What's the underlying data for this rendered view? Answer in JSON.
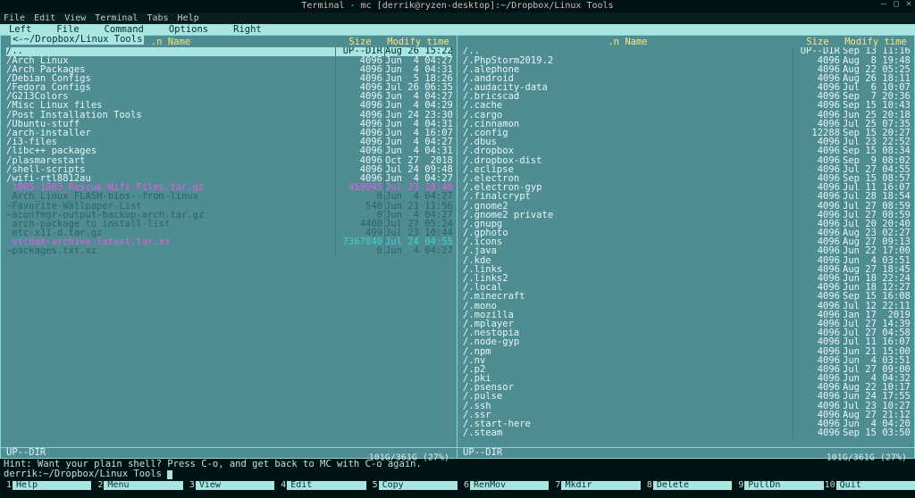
{
  "window": {
    "title": "Terminal - mc [derrik@ryzen-desktop]:~/Dropbox/Linux Tools"
  },
  "appmenu": [
    "File",
    "Edit",
    "View",
    "Terminal",
    "Tabs",
    "Help"
  ],
  "mcmenu": [
    "Left",
    "File",
    "Command",
    "Options",
    "Right"
  ],
  "left_path_caption": "<-~/Dropbox/Linux Tools",
  "headers": {
    "name": ".n          Name",
    "size": "Size",
    "mtime": "Modify time"
  },
  "left": {
    "status": "UP--DIR",
    "disk": "101G/361G (27%)",
    "items": [
      {
        "cls": "sel",
        "name": "/..",
        "size": "UP--DIR",
        "mtime": "Aug 26 15:22"
      },
      {
        "cls": "dir",
        "name": "/Arch Linux",
        "size": "4096",
        "mtime": "Jun  4 04:27"
      },
      {
        "cls": "dir",
        "name": "/Arch Packages",
        "size": "4096",
        "mtime": "Jun  4 04:31"
      },
      {
        "cls": "dir",
        "name": "/Debian Configs",
        "size": "4096",
        "mtime": "Jun  5 18:26"
      },
      {
        "cls": "dir",
        "name": "/Fedora Configs",
        "size": "4096",
        "mtime": "Jul 26 06:35"
      },
      {
        "cls": "dir",
        "name": "/G213Colors",
        "size": "4096",
        "mtime": "Jun  4 04:27"
      },
      {
        "cls": "dir",
        "name": "/Misc Linux files",
        "size": "4096",
        "mtime": "Jun  4 04:29"
      },
      {
        "cls": "dir",
        "name": "/Post Installation Tools",
        "size": "4096",
        "mtime": "Jun 24 23:30"
      },
      {
        "cls": "dir",
        "name": "/Ubuntu-stuff",
        "size": "4096",
        "mtime": "Jun  4 04:31"
      },
      {
        "cls": "dir",
        "name": "/arch-installer",
        "size": "4096",
        "mtime": "Jun  4 16:07"
      },
      {
        "cls": "dir",
        "name": "/i3-files",
        "size": "4096",
        "mtime": "Jun  4 04:27"
      },
      {
        "cls": "dir",
        "name": "/libc++ packages",
        "size": "4096",
        "mtime": "Jun  4 04:31"
      },
      {
        "cls": "dir",
        "name": "/plasmarestart",
        "size": "4096",
        "mtime": "Oct 27  2018"
      },
      {
        "cls": "dir",
        "name": "/shell-scripts",
        "size": "4096",
        "mtime": "Jul 24 09:48"
      },
      {
        "cls": "dir",
        "name": "/wifi-rtl8812au",
        "size": "4096",
        "mtime": "Jun  4 04:27"
      },
      {
        "cls": "mag",
        "name": " 1805-1803_Rescue-Wifi-Files.tar.gz",
        "size": "459945",
        "mtime": "Jul 23 18:40"
      },
      {
        "cls": "gray",
        "name": " Arch_Linux_FLASH-bios--from-linux",
        "size": "0",
        "mtime": "Jun  4 04:27"
      },
      {
        "cls": "gray",
        "name": "~Favorite-Wallpaper-List",
        "size": "540",
        "mtime": "Jun 21 11:56"
      },
      {
        "cls": "gray",
        "name": "~aconfmgr-output-backup-arch.tar.gz",
        "size": "0",
        "mtime": "Jun  4 04:27"
      },
      {
        "cls": "gray",
        "name": " arch-package_to_install-list",
        "size": "4400",
        "mtime": "Jul 27 05:24"
      },
      {
        "cls": "gray",
        "name": " etc-x11-d.tar.gz",
        "size": "499",
        "mtime": "Jul 23 10:44"
      },
      {
        "cls": "mag2",
        "name": " etcbak-archive-latest.tar.xz",
        "size": "7367840",
        "mtime": "Jul 24 04:55"
      },
      {
        "cls": "gray",
        "name": "~packages.txt.xz",
        "size": "0",
        "mtime": "Jun  4 04:27"
      }
    ]
  },
  "right": {
    "status": "UP--DIR",
    "disk": "101G/361G (27%)",
    "items": [
      {
        "cls": "dir",
        "name": "/..",
        "size": "UP--DIR",
        "mtime": "Sep 13 11:16"
      },
      {
        "cls": "dir",
        "name": "/.PhpStorm2019.2",
        "size": "4096",
        "mtime": "Aug  8 19:48"
      },
      {
        "cls": "dir",
        "name": "/.alephone",
        "size": "4096",
        "mtime": "Aug 22 05:25"
      },
      {
        "cls": "dir",
        "name": "/.android",
        "size": "4096",
        "mtime": "Aug 26 18:11"
      },
      {
        "cls": "dir",
        "name": "/.audacity-data",
        "size": "4096",
        "mtime": "Jul  6 10:07"
      },
      {
        "cls": "dir",
        "name": "/.bricscad",
        "size": "4096",
        "mtime": "Sep  7 20:36"
      },
      {
        "cls": "dir",
        "name": "/.cache",
        "size": "4096",
        "mtime": "Sep 15 10:43"
      },
      {
        "cls": "dir",
        "name": "/.cargo",
        "size": "4096",
        "mtime": "Jun 25 20:18"
      },
      {
        "cls": "dir",
        "name": "/.cinnamon",
        "size": "4096",
        "mtime": "Jul 25 07:35"
      },
      {
        "cls": "dir",
        "name": "/.config",
        "size": "12288",
        "mtime": "Sep 15 20:27"
      },
      {
        "cls": "dir",
        "name": "/.dbus",
        "size": "4096",
        "mtime": "Jul 23 22:52"
      },
      {
        "cls": "dir",
        "name": "/.dropbox",
        "size": "4096",
        "mtime": "Sep 15 08:34"
      },
      {
        "cls": "dir",
        "name": "/.dropbox-dist",
        "size": "4096",
        "mtime": "Sep  9 08:02"
      },
      {
        "cls": "dir",
        "name": "/.eclipse",
        "size": "4096",
        "mtime": "Jul 27 04:55"
      },
      {
        "cls": "dir",
        "name": "/.electron",
        "size": "4096",
        "mtime": "Sep 15 08:57"
      },
      {
        "cls": "dir",
        "name": "/.electron-gyp",
        "size": "4096",
        "mtime": "Jul 11 16:07"
      },
      {
        "cls": "dir",
        "name": "/.finalcrypt",
        "size": "4096",
        "mtime": "Jul 28 18:54"
      },
      {
        "cls": "dir",
        "name": "/.gnome2",
        "size": "4096",
        "mtime": "Jul 27 08:59"
      },
      {
        "cls": "dir",
        "name": "/.gnome2_private",
        "size": "4096",
        "mtime": "Jul 27 08:59"
      },
      {
        "cls": "dir",
        "name": "/.gnupg",
        "size": "4096",
        "mtime": "Jul 20 20:40"
      },
      {
        "cls": "dir",
        "name": "/.gphoto",
        "size": "4096",
        "mtime": "Aug 23 02:27"
      },
      {
        "cls": "dir",
        "name": "/.icons",
        "size": "4096",
        "mtime": "Aug 27 09:13"
      },
      {
        "cls": "dir",
        "name": "/.java",
        "size": "4096",
        "mtime": "Jun 22 17:00"
      },
      {
        "cls": "dir",
        "name": "/.kde",
        "size": "4096",
        "mtime": "Jun  4 03:51"
      },
      {
        "cls": "dir",
        "name": "/.links",
        "size": "4096",
        "mtime": "Aug 27 18:45"
      },
      {
        "cls": "dir",
        "name": "/.links2",
        "size": "4096",
        "mtime": "Jun 18 22:24"
      },
      {
        "cls": "dir",
        "name": "/.local",
        "size": "4096",
        "mtime": "Jun 18 12:27"
      },
      {
        "cls": "dir",
        "name": "/.minecraft",
        "size": "4096",
        "mtime": "Sep 15 16:08"
      },
      {
        "cls": "dir",
        "name": "/.mono",
        "size": "4096",
        "mtime": "Jul 12 22:11"
      },
      {
        "cls": "dir",
        "name": "/.mozilla",
        "size": "4096",
        "mtime": "Jan 17  2019"
      },
      {
        "cls": "dir",
        "name": "/.mplayer",
        "size": "4096",
        "mtime": "Jul 27 14:39"
      },
      {
        "cls": "dir",
        "name": "/.nestopia",
        "size": "4096",
        "mtime": "Jul 27 04:58"
      },
      {
        "cls": "dir",
        "name": "/.node-gyp",
        "size": "4096",
        "mtime": "Jul 11 16:07"
      },
      {
        "cls": "dir",
        "name": "/.npm",
        "size": "4096",
        "mtime": "Jun 21 15:00"
      },
      {
        "cls": "dir",
        "name": "/.nv",
        "size": "4096",
        "mtime": "Jun  4 03:51"
      },
      {
        "cls": "dir",
        "name": "/.p2",
        "size": "4096",
        "mtime": "Jul 27 09:00"
      },
      {
        "cls": "dir",
        "name": "/.pki",
        "size": "4096",
        "mtime": "Jun  4 04:32"
      },
      {
        "cls": "dir",
        "name": "/.psensor",
        "size": "4096",
        "mtime": "Aug 22 10:17"
      },
      {
        "cls": "dir",
        "name": "/.pulse",
        "size": "4096",
        "mtime": "Jun 24 17:55"
      },
      {
        "cls": "dir",
        "name": "/.ssh",
        "size": "4096",
        "mtime": "Jul 23 10:27"
      },
      {
        "cls": "dir",
        "name": "/.ssr",
        "size": "4096",
        "mtime": "Aug 27 21:12"
      },
      {
        "cls": "dir",
        "name": "/.start-here",
        "size": "4096",
        "mtime": "Jun  4 04:20"
      },
      {
        "cls": "dir",
        "name": "/.steam",
        "size": "4096",
        "mtime": "Sep 15 03:50"
      }
    ]
  },
  "hint": "Hint: Want your plain shell? Press C-o, and get back to MC with C-o again.",
  "prompt": "derrik:~/Dropbox/Linux Tools ",
  "fkeys": [
    {
      "n": "1",
      "l": "Help"
    },
    {
      "n": "2",
      "l": "Menu"
    },
    {
      "n": "3",
      "l": "View"
    },
    {
      "n": "4",
      "l": "Edit"
    },
    {
      "n": "5",
      "l": "Copy"
    },
    {
      "n": "6",
      "l": "RenMov"
    },
    {
      "n": "7",
      "l": "Mkdir"
    },
    {
      "n": "8",
      "l": "Delete"
    },
    {
      "n": "9",
      "l": "PullDn"
    },
    {
      "n": "10",
      "l": "Quit"
    }
  ]
}
